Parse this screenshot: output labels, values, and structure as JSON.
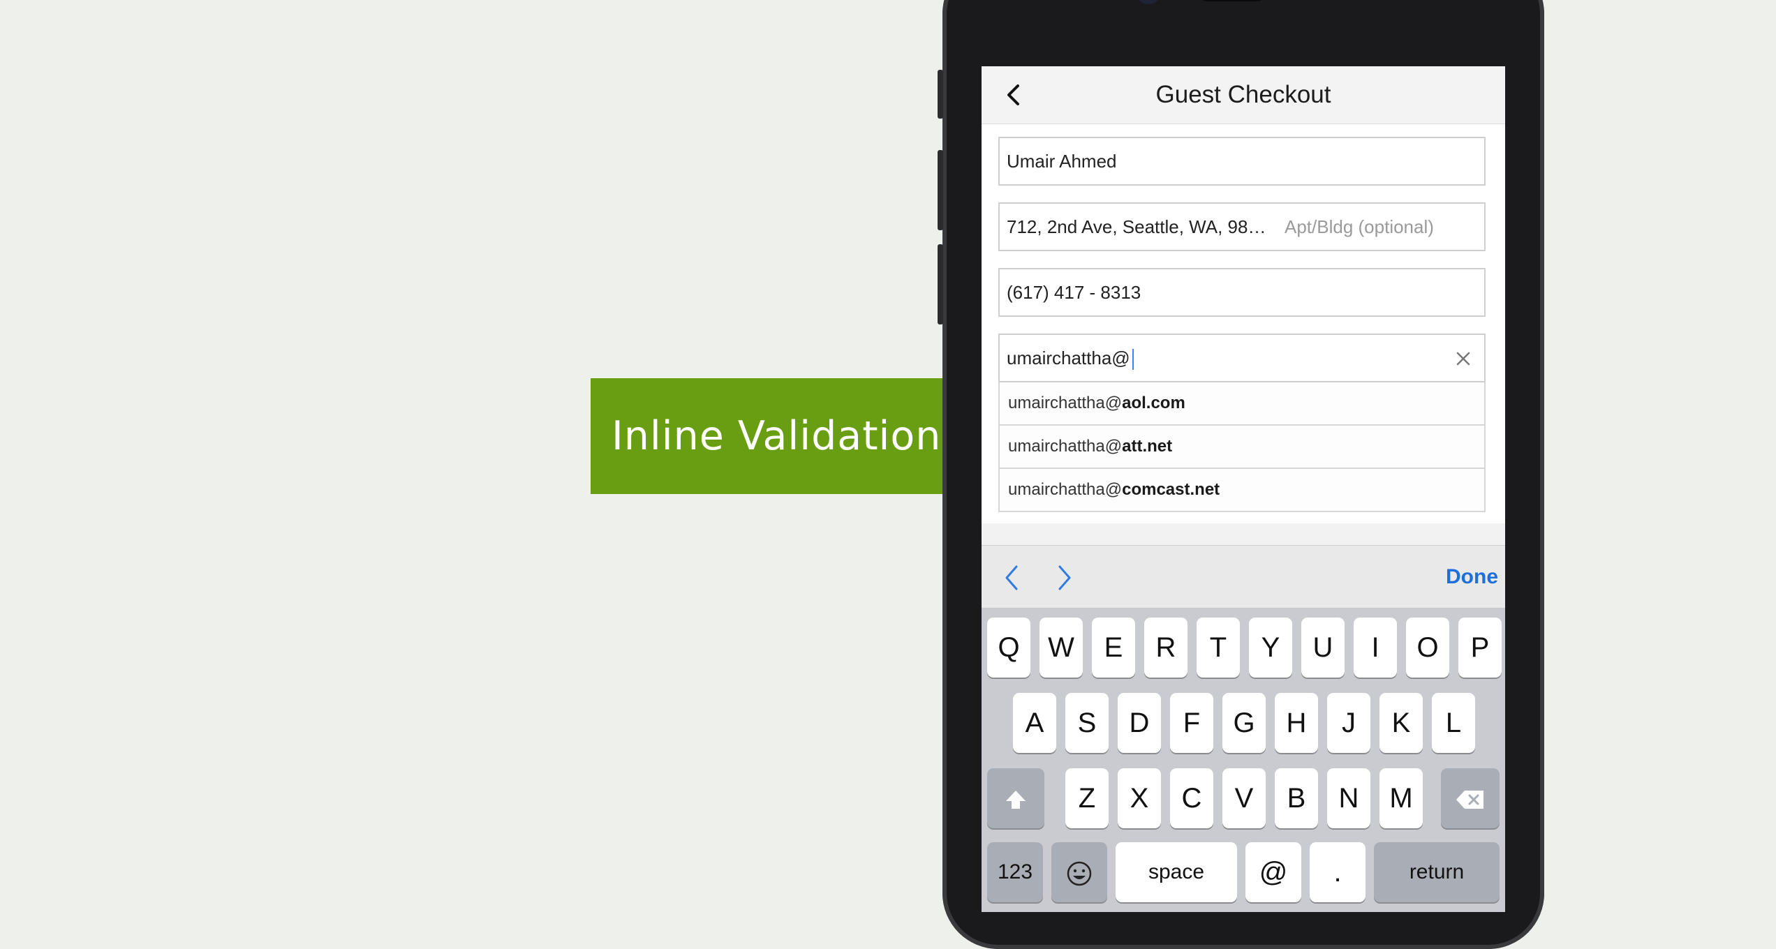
{
  "callout": {
    "label": "Inline Validation",
    "color": "#6a9e12"
  },
  "nav": {
    "title": "Guest Checkout",
    "back_icon": "chevron-left-icon"
  },
  "form": {
    "name_value": "Umair Ahmed",
    "address_value": "712, 2nd Ave, Seattle, WA, 98…",
    "apt_placeholder": "Apt/Bldg (optional)",
    "phone_value": "(617) 417 - 8313",
    "email_value": "umairchattha@"
  },
  "suggestions": [
    {
      "prefix": "umairchattha@",
      "domain": "aol.com"
    },
    {
      "prefix": "umairchattha@",
      "domain": "att.net"
    },
    {
      "prefix": "umairchattha@",
      "domain": "comcast.net"
    }
  ],
  "accessory": {
    "done_label": "Done",
    "prev_icon": "chevron-left-icon",
    "next_icon": "chevron-right-icon"
  },
  "keyboard": {
    "row1": [
      "Q",
      "W",
      "E",
      "R",
      "T",
      "Y",
      "U",
      "I",
      "O",
      "P"
    ],
    "row2": [
      "A",
      "S",
      "D",
      "F",
      "G",
      "H",
      "J",
      "K",
      "L"
    ],
    "row3": [
      "Z",
      "X",
      "C",
      "V",
      "B",
      "N",
      "M"
    ],
    "numbers_label": "123",
    "space_label": "space",
    "at_label": "@",
    "dot_label": ".",
    "return_label": "return"
  },
  "colors": {
    "accent": "#1e6fd9",
    "background": "#eef0ec"
  }
}
